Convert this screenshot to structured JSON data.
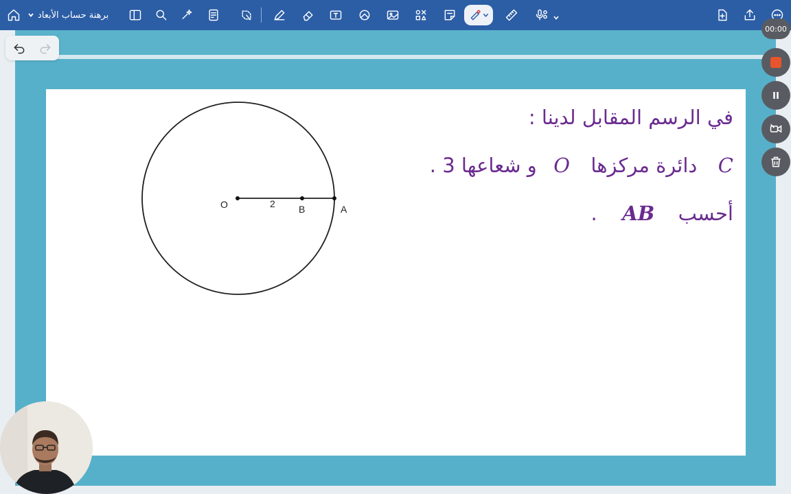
{
  "toolbar": {
    "document_title": "برهنة حساب الأبعاد",
    "icons": [
      "home-icon",
      "sidebar-icon",
      "search-icon",
      "ai-sparkle-icon",
      "export-notes-icon",
      "lasso-icon",
      "pen-icon",
      "eraser-icon",
      "text-box-icon",
      "shapes-icon",
      "image-icon",
      "elements-icon",
      "sticky-note-icon",
      "laser-pointer-icon",
      "ruler-icon",
      "microphone-icon",
      "add-page-icon",
      "share-icon",
      "more-icon"
    ]
  },
  "recording": {
    "timer": "00:00",
    "colors": {
      "stop": "#e8542c",
      "control_bg": "#585c62"
    }
  },
  "content": {
    "line1": "في الرسم المقابل لدينا :",
    "line2_text_a": "دائرة مركزها",
    "line2_math_c": "C",
    "line2_math_o": "O",
    "line2_text_b": "و شعاعها 3 .",
    "line3_text": "أحسب",
    "line3_math": "AB",
    "line3_dot": "."
  },
  "figure": {
    "label_o": "O",
    "label_b": "B",
    "label_a": "A",
    "segment_label": "2"
  },
  "colors": {
    "toolbar_bg": "#2c5ea6",
    "frame_bg": "#57b0c9",
    "text_purple": "#6a2b8f"
  }
}
